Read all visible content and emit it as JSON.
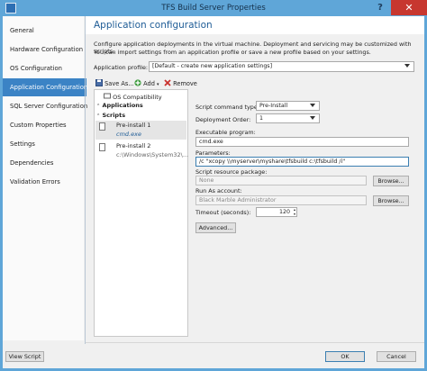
{
  "window": {
    "title": "TFS Build Server Properties",
    "help_glyph": "?",
    "close_glyph": "✕"
  },
  "nav": {
    "items": [
      {
        "label": "General"
      },
      {
        "label": "Hardware Configuration"
      },
      {
        "label": "OS Configuration"
      },
      {
        "label": "Application Configuration"
      },
      {
        "label": "SQL Server Configuration"
      },
      {
        "label": "Custom Properties"
      },
      {
        "label": "Settings"
      },
      {
        "label": "Dependencies"
      },
      {
        "label": "Validation Errors"
      }
    ],
    "selected_index": 3
  },
  "page": {
    "title": "Application configuration",
    "description_line1": "Configure application deployments in the virtual machine. Deployment and servicing may be customized with scripts.",
    "description_line2": "You can import settings from an application profile or save a new profile based on your settings.",
    "profile_label": "Application profile:",
    "profile_value": "[Default - create new application settings]"
  },
  "toolbar": {
    "save_as": "Save As...",
    "add": "Add",
    "remove": "Remove"
  },
  "tree": {
    "os_compat": "OS Compatibility",
    "applications": "Applications",
    "scripts": "Scripts",
    "items": [
      {
        "name": "Pre-install 1",
        "detail": "cmd.exe"
      },
      {
        "name": "Pre-install 2",
        "detail": "c:\\Windows\\System32\\..."
      }
    ]
  },
  "form": {
    "script_command_type_label": "Script command type:",
    "script_command_type_value": "Pre-Install",
    "deployment_order_label": "Deployment Order:",
    "deployment_order_value": "1",
    "executable_label": "Executable program:",
    "executable_value": "cmd.exe",
    "parameters_label": "Parameters:",
    "parameters_value": "/c \"xcopy \\\\myserver\\myshare\\tfsbuild c:\\tfsbuild /i\"",
    "resource_package_label": "Script resource package:",
    "resource_package_value": "None",
    "browse_label": "Browse...",
    "run_as_label": "Run As account:",
    "run_as_value": "Black Marble Administrator",
    "timeout_label": "Timeout (seconds):",
    "timeout_value": "120",
    "advanced_label": "Advanced..."
  },
  "footer": {
    "view_script": "View Script",
    "ok": "OK",
    "cancel": "Cancel"
  },
  "colors": {
    "accent": "#3b83c5",
    "title_blue": "#1e5c96",
    "frame": "#5fa6d8",
    "close_red": "#c7372f"
  }
}
